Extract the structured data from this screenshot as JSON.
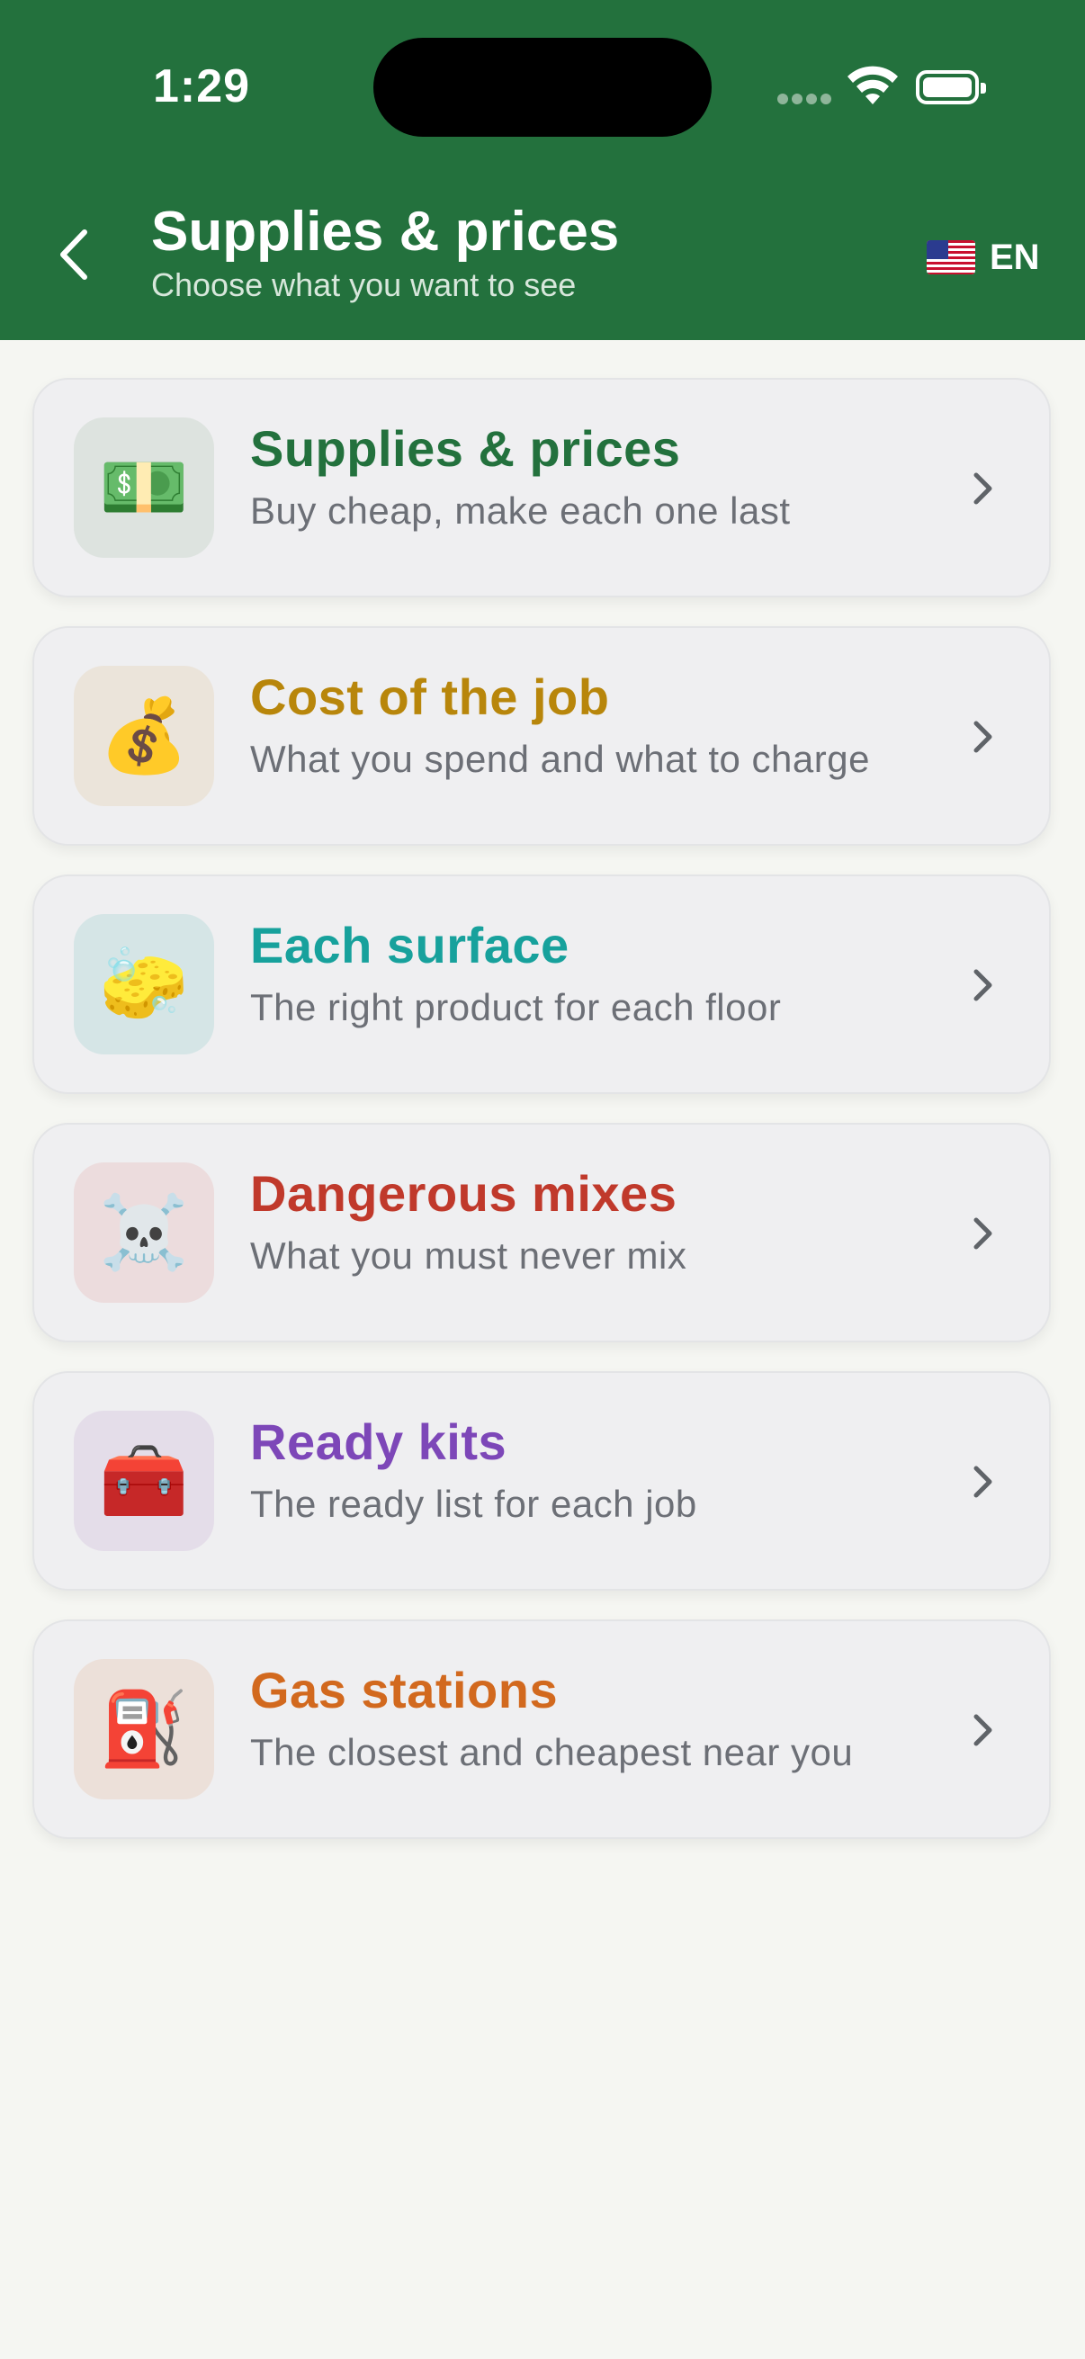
{
  "status_bar": {
    "time": "1:29"
  },
  "header": {
    "title": "Supplies & prices",
    "subtitle": "Choose what you want to see",
    "language": {
      "flag": "🇺🇸",
      "code": "EN"
    }
  },
  "colors": {
    "header_bg": "#23713d",
    "page_bg": "#f5f6f2"
  },
  "menu": [
    {
      "title": "Supplies & prices",
      "subtitle": "Buy cheap, make each one last",
      "icon": "💵",
      "icon_name": "money-icon",
      "title_color": "#23713d",
      "icon_bg": "#dde3df"
    },
    {
      "title": "Cost of the job",
      "subtitle": "What you spend and what to charge",
      "icon": "💰",
      "icon_name": "money-bag-icon",
      "title_color": "#b8860b",
      "icon_bg": "#ebe4da"
    },
    {
      "title": "Each surface",
      "subtitle": "The right product for each floor",
      "icon": "🧽",
      "icon_name": "sponge-icon",
      "title_color": "#17a19c",
      "icon_bg": "#d5e5e6"
    },
    {
      "title": "Dangerous mixes",
      "subtitle": "What you must never mix",
      "icon": "☠️",
      "icon_name": "skull-icon",
      "title_color": "#c0392b",
      "icon_bg": "#ecdcdd"
    },
    {
      "title": "Ready kits",
      "subtitle": "The ready list for each job",
      "icon": "🧰",
      "icon_name": "toolbox-icon",
      "title_color": "#7d47b8",
      "icon_bg": "#e4dde9"
    },
    {
      "title": "Gas stations",
      "subtitle": "The closest and cheapest near you",
      "icon": "⛽",
      "icon_name": "fuel-pump-icon",
      "title_color": "#d2691e",
      "icon_bg": "#ece0d9"
    }
  ]
}
